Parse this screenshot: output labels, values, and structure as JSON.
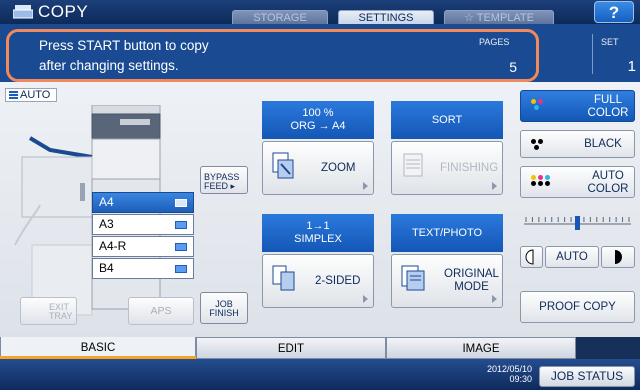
{
  "app": {
    "title": "COPY"
  },
  "top_tabs": {
    "storage": "STORAGE",
    "settings": "SETTINGS",
    "template": "TEMPLATE",
    "help": "?"
  },
  "message": {
    "line1": "Press START button to copy",
    "line2": "after changing settings."
  },
  "counters": {
    "pages_label": "PAGES",
    "pages_value": "5",
    "set_label": "SET",
    "set_value": "1"
  },
  "auto_tag": "AUTO",
  "trays": [
    {
      "label": "A4",
      "selected": true
    },
    {
      "label": "A3",
      "selected": false
    },
    {
      "label": "A4-R",
      "selected": false
    },
    {
      "label": "B4",
      "selected": false
    }
  ],
  "side_buttons": {
    "bypass_line1": "BYPASS",
    "bypass_line2": "FEED",
    "exit_line1": "EXIT",
    "exit_line2": "TRAY",
    "aps": "APS",
    "jobfinish_line1": "JOB",
    "jobfinish_line2": "FINISH"
  },
  "zoom": {
    "percent": "100 %",
    "orig": "ORG",
    "arrow": "→",
    "paper": "A4",
    "label": "ZOOM"
  },
  "finishing": {
    "header": "SORT",
    "label": "FINISHING"
  },
  "duplex": {
    "header_line1": "1→1",
    "header_line2": "SIMPLEX",
    "label": "2-SIDED"
  },
  "original": {
    "header": "TEXT/PHOTO",
    "label_line1": "ORIGINAL",
    "label_line2": "MODE"
  },
  "color_modes": {
    "full_line1": "FULL",
    "full_line2": "COLOR",
    "black": "BLACK",
    "auto_line1": "AUTO",
    "auto_line2": "COLOR"
  },
  "density": {
    "auto": "AUTO",
    "level": 0.5
  },
  "proof_copy": "PROOF COPY",
  "bottom_tabs": [
    "BASIC",
    "EDIT",
    "IMAGE"
  ],
  "status": {
    "date": "2012/05/10",
    "time": "09:30",
    "job_status": "JOB STATUS"
  },
  "colors": {
    "accent_blue": "#1457b5",
    "message_bar": "#1a4a91",
    "highlight_outline": "#f08a5d"
  }
}
